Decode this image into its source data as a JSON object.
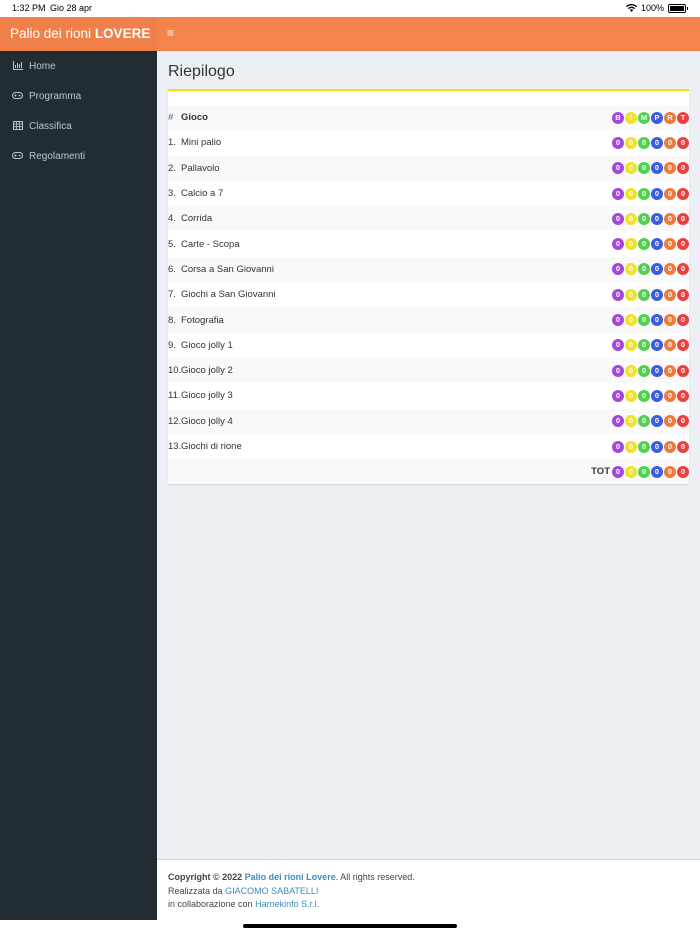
{
  "status": {
    "time": "1:32 PM",
    "date": "Gio 28 apr",
    "battery": "100%"
  },
  "brand": {
    "prefix": "Palio dei rioni",
    "name": "LOVERE"
  },
  "sidebar": {
    "items": [
      {
        "label": "Home",
        "icon": "bar-chart-icon"
      },
      {
        "label": "Programma",
        "icon": "gamepad-icon"
      },
      {
        "label": "Classifica",
        "icon": "table-icon"
      },
      {
        "label": "Regolamenti",
        "icon": "gamepad-icon"
      }
    ]
  },
  "page": {
    "title": "Riepilogo"
  },
  "table": {
    "header": {
      "num": "#",
      "name": "Gioco"
    },
    "columns": [
      {
        "key": "B",
        "color": "#a347de"
      },
      {
        "key": "I",
        "color": "#f1e12b"
      },
      {
        "key": "M",
        "color": "#4fd34f"
      },
      {
        "key": "P",
        "color": "#3d5ce0"
      },
      {
        "key": "R",
        "color": "#ee7b3c"
      },
      {
        "key": "T",
        "color": "#e8413f"
      }
    ],
    "rows": [
      {
        "num": "1.",
        "name": "Mini palio",
        "scores": [
          "0",
          "0",
          "0",
          "0",
          "0",
          "0"
        ]
      },
      {
        "num": "2.",
        "name": "Pallavolo",
        "scores": [
          "0",
          "0",
          "0",
          "0",
          "0",
          "0"
        ]
      },
      {
        "num": "3.",
        "name": "Calcio a 7",
        "scores": [
          "0",
          "0",
          "0",
          "0",
          "0",
          "0"
        ]
      },
      {
        "num": "4.",
        "name": "Corrida",
        "scores": [
          "0",
          "0",
          "0",
          "0",
          "0",
          "0"
        ]
      },
      {
        "num": "5.",
        "name": "Carte - Scopa",
        "scores": [
          "0",
          "0",
          "0",
          "0",
          "0",
          "0"
        ]
      },
      {
        "num": "6.",
        "name": "Corsa a San Giovanni",
        "scores": [
          "0",
          "0",
          "0",
          "0",
          "0",
          "0"
        ]
      },
      {
        "num": "7.",
        "name": "Giochi a San Giovanni",
        "scores": [
          "0",
          "0",
          "0",
          "0",
          "0",
          "0"
        ]
      },
      {
        "num": "8.",
        "name": "Fotografia",
        "scores": [
          "0",
          "0",
          "0",
          "0",
          "0",
          "0"
        ]
      },
      {
        "num": "9.",
        "name": "Gioco jolly 1",
        "scores": [
          "0",
          "0",
          "0",
          "0",
          "0",
          "0"
        ]
      },
      {
        "num": "10.",
        "name": "Gioco jolly 2",
        "scores": [
          "0",
          "0",
          "0",
          "0",
          "0",
          "0"
        ]
      },
      {
        "num": "11.",
        "name": "Gioco jolly 3",
        "scores": [
          "0",
          "0",
          "0",
          "0",
          "0",
          "0"
        ]
      },
      {
        "num": "12.",
        "name": "Gioco jolly 4",
        "scores": [
          "0",
          "0",
          "0",
          "0",
          "0",
          "0"
        ]
      },
      {
        "num": "13.",
        "name": "Giochi di rione",
        "scores": [
          "0",
          "0",
          "0",
          "0",
          "0",
          "0"
        ]
      }
    ],
    "total": {
      "label": "TOT",
      "scores": [
        "0",
        "0",
        "0",
        "0",
        "0",
        "0"
      ]
    }
  },
  "footer": {
    "copyright": "Copyright © 2022",
    "site_link": "Palio dei rioni Lovere",
    "rights": ". All rights reserved.",
    "made_by_label": "Realizzata da",
    "author_link": "GIACOMO SABATELLI",
    "collab_label": "in collaborazione con",
    "partner_link": "Harnekinfo S.r.l."
  }
}
